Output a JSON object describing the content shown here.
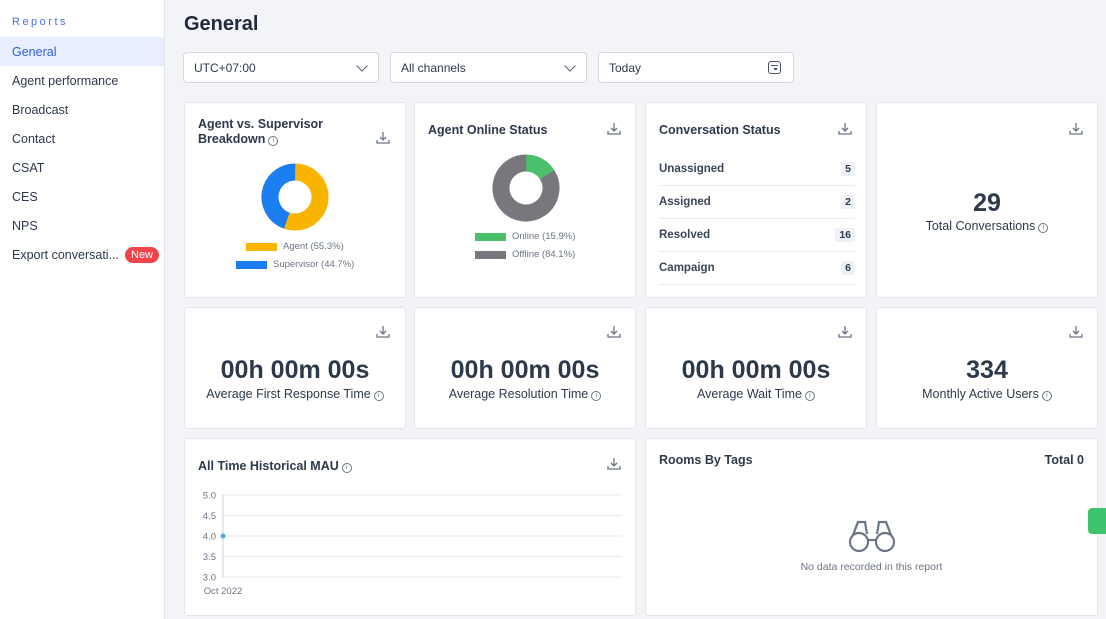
{
  "sidebar": {
    "heading": "Reports",
    "items": [
      {
        "label": "General"
      },
      {
        "label": "Agent performance"
      },
      {
        "label": "Broadcast"
      },
      {
        "label": "Contact"
      },
      {
        "label": "CSAT"
      },
      {
        "label": "CES"
      },
      {
        "label": "NPS"
      },
      {
        "label": "Export conversati...",
        "badge": "New"
      }
    ]
  },
  "page": {
    "title": "General"
  },
  "filters": {
    "timezone": "UTC+07:00",
    "channels": "All channels",
    "date": "Today"
  },
  "agent_vs_supervisor": {
    "title_line1": "Agent vs. Supervisor",
    "title_line2": "Breakdown",
    "legend": [
      {
        "label": "Agent (55.3%)",
        "value": 55.3,
        "color": "#f8b400"
      },
      {
        "label": "Supervisor (44.7%)",
        "value": 44.7,
        "color": "#1a7ef0"
      }
    ]
  },
  "agent_online_status": {
    "title": "Agent Online Status",
    "legend": [
      {
        "label": "Online (15.9%)",
        "value": 15.9,
        "color": "#4cbf6a"
      },
      {
        "label": "Offline (84.1%)",
        "value": 84.1,
        "color": "#77777d"
      }
    ]
  },
  "conversation_status": {
    "title": "Conversation Status",
    "rows": [
      {
        "label": "Unassigned",
        "count": "5"
      },
      {
        "label": "Assigned",
        "count": "2"
      },
      {
        "label": "Resolved",
        "count": "16"
      },
      {
        "label": "Campaign",
        "count": "6"
      }
    ]
  },
  "total_conversations": {
    "value": "29",
    "label": "Total Conversations"
  },
  "avg_first_response": {
    "value": "00h 00m 00s",
    "label": "Average First Response Time"
  },
  "avg_resolution": {
    "value": "00h 00m 00s",
    "label": "Average Resolution Time"
  },
  "avg_wait": {
    "value": "00h 00m 00s",
    "label": "Average Wait Time"
  },
  "monthly_active_users": {
    "value": "334",
    "label": "Monthly Active Users"
  },
  "historical_mau": {
    "title": "All Time Historical MAU"
  },
  "rooms_by_tags": {
    "title": "Rooms By Tags",
    "total": "Total 0",
    "empty_text": "No data recorded in this report"
  },
  "chart_data": {
    "type": "line",
    "title": "All Time Historical MAU",
    "categories": [
      "Oct 2022"
    ],
    "y_ticks": [
      "5.0",
      "4.5",
      "4.0",
      "3.5",
      "3.0"
    ],
    "ylim": [
      3.0,
      5.0
    ],
    "series": [
      {
        "values": [
          4.0
        ]
      }
    ],
    "grid": true,
    "color": "#5aa9e6"
  }
}
